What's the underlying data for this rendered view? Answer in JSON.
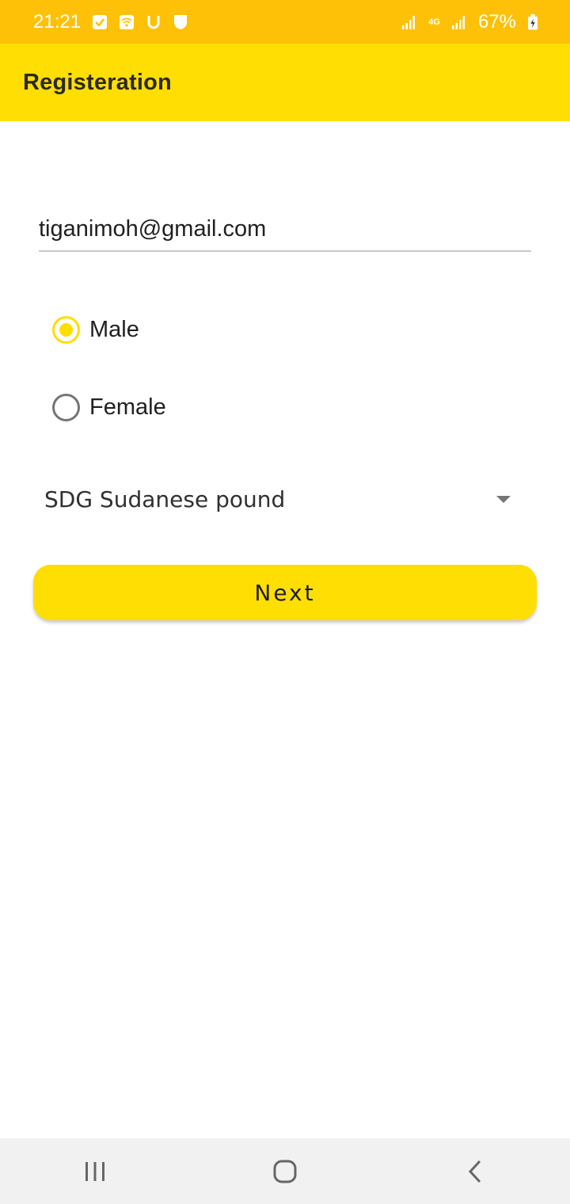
{
  "status_bar": {
    "time": "21:21",
    "network": "4G",
    "battery": "67%",
    "left_icons": [
      "checkbox-icon",
      "wifi-hotspot-icon",
      "u-icon",
      "shield-icon"
    ],
    "right_icons": [
      "signal-icon",
      "signal-icon",
      "battery-icon"
    ]
  },
  "app_bar": {
    "title": "Registeration"
  },
  "form": {
    "email": {
      "value": "tiganimoh@gmail.com",
      "placeholder": ""
    },
    "gender": {
      "options": [
        {
          "label": "Male",
          "checked": true
        },
        {
          "label": "Female",
          "checked": false
        }
      ]
    },
    "currency": {
      "selected": "SDG Sudanese pound"
    },
    "next_label": "Next"
  },
  "nav_bar": {
    "items": [
      "recents-icon",
      "home-icon",
      "back-icon"
    ]
  },
  "colors": {
    "status_bar": "#FFC107",
    "accent": "#FFDE03",
    "nav_bar": "#F1F1F1"
  }
}
